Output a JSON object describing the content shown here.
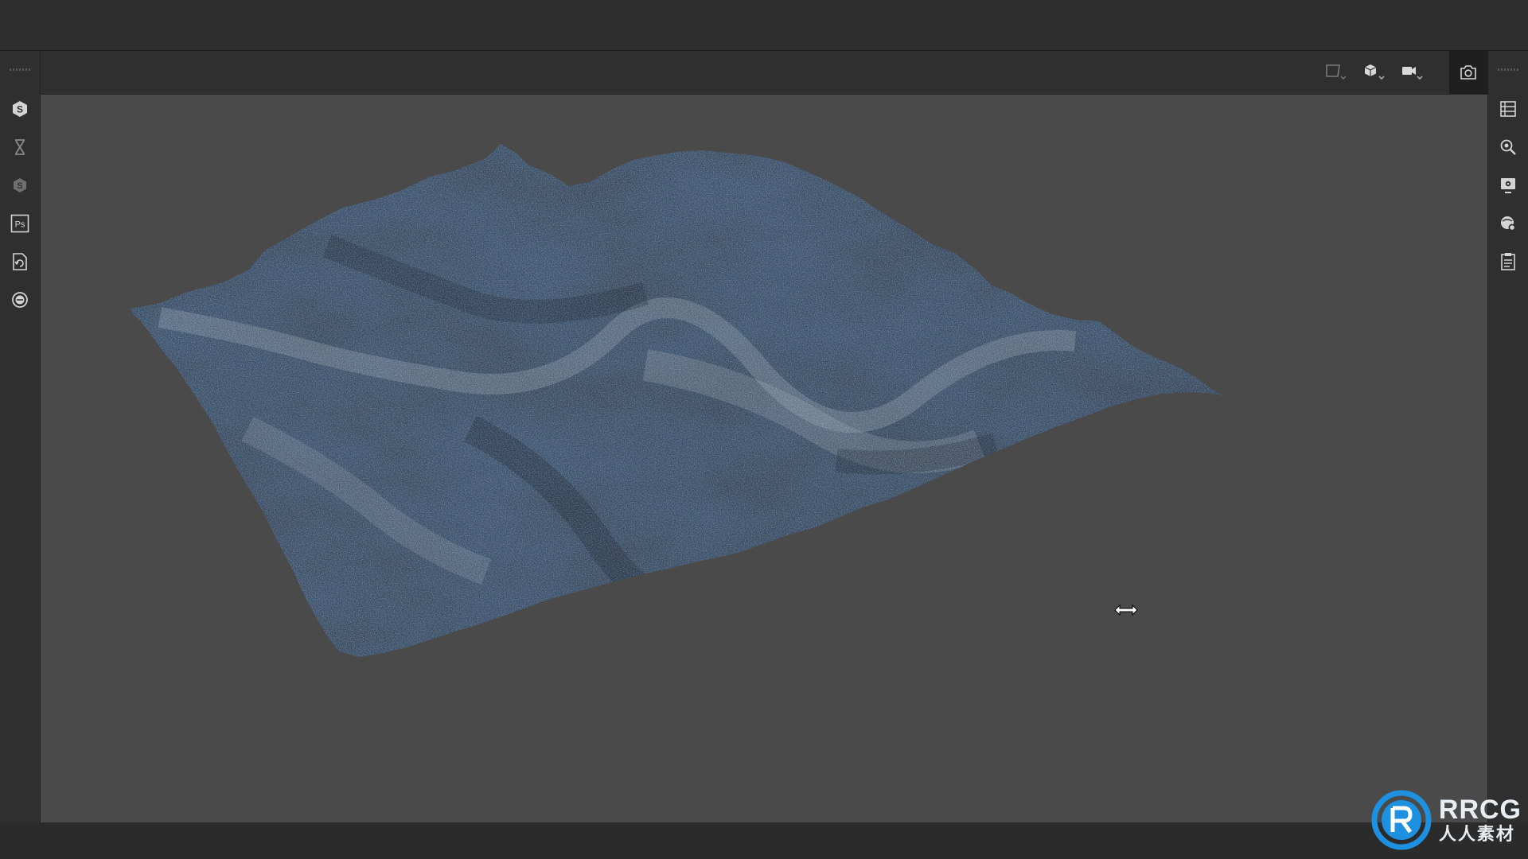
{
  "app": {
    "accent_color": "#2b8fd8",
    "viewport_background": "#4a4a4a"
  },
  "left_toolbar": {
    "items": [
      {
        "icon": "substance-s-icon"
      },
      {
        "icon": "hourglass-icon"
      },
      {
        "icon": "substance-s-dim-icon"
      },
      {
        "icon": "photoshop-icon",
        "label": "Ps"
      },
      {
        "icon": "file-refresh-icon"
      },
      {
        "icon": "substance-circle-icon"
      }
    ]
  },
  "right_toolbar": {
    "items": [
      {
        "icon": "layers-list-icon"
      },
      {
        "icon": "zoom-search-icon"
      },
      {
        "icon": "display-settings-icon"
      },
      {
        "icon": "environment-settings-icon"
      },
      {
        "icon": "clipboard-notes-icon"
      }
    ]
  },
  "viewport_toolbar": {
    "items": [
      {
        "icon": "view-frame-icon",
        "has_dropdown": true
      },
      {
        "icon": "cube-display-icon",
        "has_dropdown": true
      },
      {
        "icon": "video-camera-icon",
        "has_dropdown": true
      },
      {
        "icon": "screenshot-camera-icon",
        "has_dropdown": false
      }
    ]
  },
  "viewport": {
    "cursor": "horizontal-resize-cursor",
    "model": "terrain-mesh"
  },
  "watermark": {
    "title": "RRCG",
    "subtitle": "人人素材"
  }
}
